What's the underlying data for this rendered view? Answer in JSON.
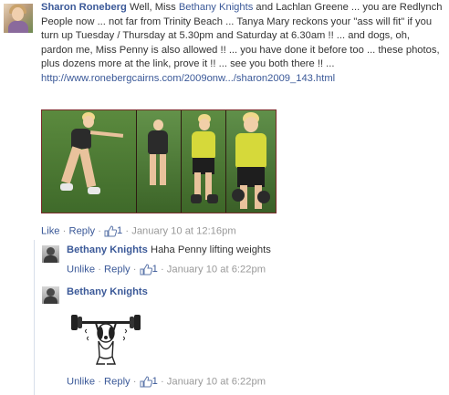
{
  "main_comment": {
    "author": "Sharon Roneberg",
    "text_part1": "Well, Miss ",
    "mention1": "Bethany Knights",
    "text_part2": " and Lachlan Greene ... you are Redlynch People now ... not far from Trinity Beach ... Tanya Mary reckons your \"ass will fit\" if you turn up Tuesday / Thursday at 5.30pm and Saturday at 6.30am !! ... and dogs, oh, pardon me, Miss Penny is also allowed !! ... you have done it before too ... these photos, plus dozens more at the link, prove it !! ... see you both there !! ...",
    "url": "http://www.ronebergcairns.com/2009onw.../sharon2009_143.html",
    "actions": {
      "like": "Like",
      "sep1": " · ",
      "reply": "Reply",
      "sep2": " · ",
      "likes_count": "1",
      "sep3": " · ",
      "timestamp": "January 10 at 12:16pm"
    }
  },
  "replies": [
    {
      "author": "Bethany Knights",
      "text": " Haha Penny lifting weights",
      "actions": {
        "unlike": "Unlike",
        "sep1": " · ",
        "reply": "Reply",
        "sep2": " · ",
        "likes_count": "1",
        "sep3": " · ",
        "timestamp": "January 10 at 6:22pm"
      }
    },
    {
      "author": "Bethany Knights",
      "actions": {
        "unlike": "Unlike",
        "sep1": " · ",
        "reply": "Reply",
        "sep2": " · ",
        "likes_count": "1",
        "sep3": " · ",
        "timestamp": "January 10 at 6:22pm"
      }
    }
  ],
  "colors": {
    "link": "#3b5998",
    "meta": "#999999",
    "photo_border": "#7a2a2a"
  },
  "icons": {
    "like": "thumbs-up-icon",
    "sticker": "snoopy-weightlifting-sticker"
  }
}
